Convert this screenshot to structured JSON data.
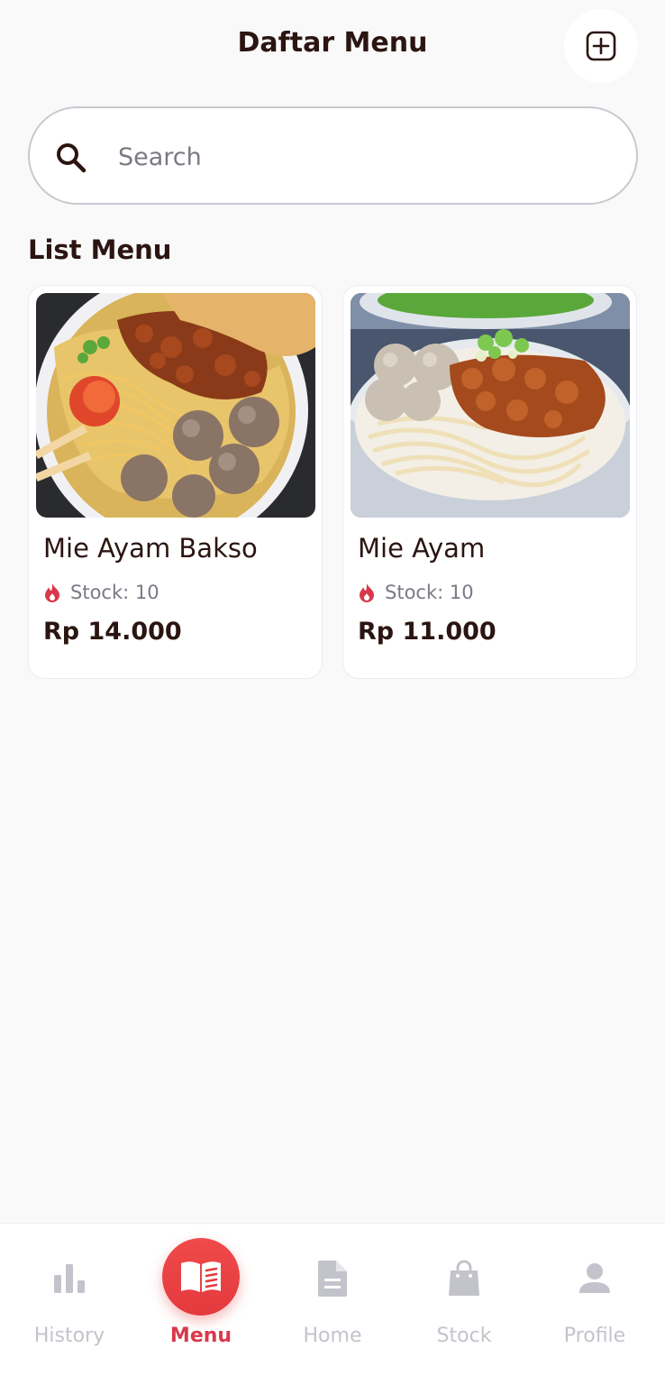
{
  "header": {
    "title": "Daftar Menu"
  },
  "search": {
    "placeholder": "Search",
    "value": ""
  },
  "section": {
    "title": "List Menu"
  },
  "menu_items": [
    {
      "name": "Mie Ayam Bakso",
      "stock": "Stock: 10",
      "price": "Rp 14.000"
    },
    {
      "name": "Mie Ayam",
      "stock": "Stock: 10",
      "price": "Rp 11.000"
    }
  ],
  "bottom_nav": [
    {
      "label": "History",
      "icon": "bar-chart-icon",
      "active": false
    },
    {
      "label": "Menu",
      "icon": "open-book-icon",
      "active": true
    },
    {
      "label": "Home",
      "icon": "document-icon",
      "active": false
    },
    {
      "label": "Stock",
      "icon": "shopping-bag-icon",
      "active": false
    },
    {
      "label": "Profile",
      "icon": "person-icon",
      "active": false
    }
  ],
  "colors": {
    "accent": "#e33a3e",
    "text_dark": "#2b1510",
    "muted": "#7a7a85",
    "inactive_nav": "#c3c3cb",
    "stock_flame": "#d9384b"
  }
}
